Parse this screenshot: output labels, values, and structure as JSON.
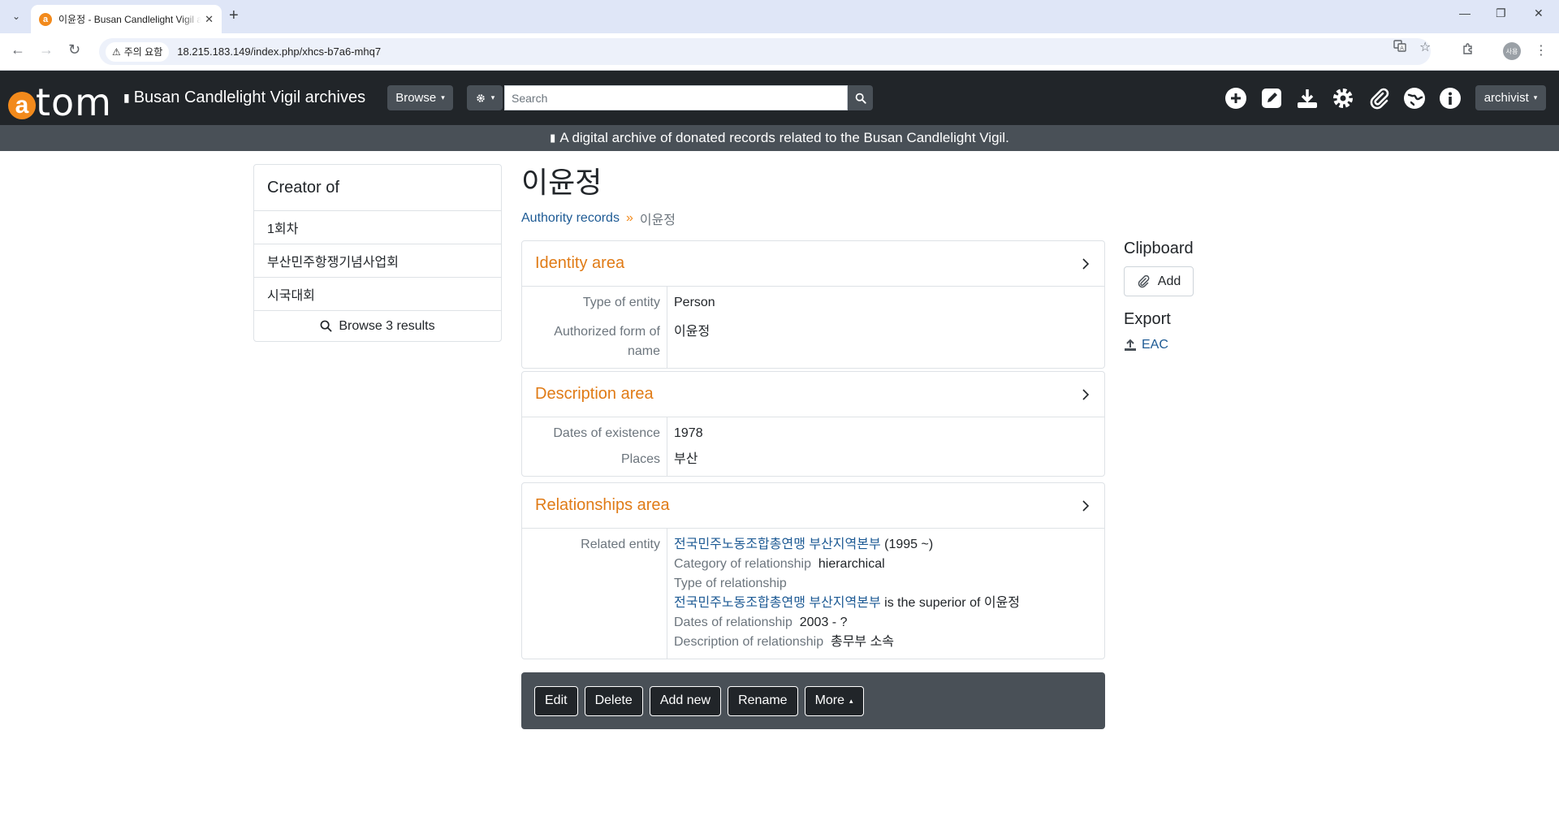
{
  "browser": {
    "tab_title": "이윤정 - Busan Candlelight Vigil archives",
    "security_label": "주의 요함",
    "url": "18.215.183.149/index.php/xhcs-b7a6-mhq7",
    "profile_initials": "사용"
  },
  "header": {
    "logo_text": "tom",
    "logo_letter": "a",
    "site_name": "Busan Candlelight Vigil archives",
    "browse_label": "Browse",
    "search_placeholder": "Search",
    "user_label": "archivist",
    "description": "A digital archive of donated records related to the Busan Candlelight Vigil."
  },
  "sidebar": {
    "heading": "Creator of",
    "items": [
      {
        "label": "1회차"
      },
      {
        "label": "부산민주항쟁기념사업회"
      },
      {
        "label": "시국대회"
      }
    ],
    "browse_label": "Browse 3 results"
  },
  "main": {
    "title": "이윤정",
    "breadcrumb": {
      "parent": "Authority records",
      "separator": "»",
      "current": "이윤정"
    },
    "identity": {
      "title": "Identity area",
      "type_label": "Type of entity",
      "type_value": "Person",
      "auth_label_1": "Authorized form of",
      "auth_label_2": "name",
      "auth_value": "이윤정"
    },
    "description": {
      "title": "Description area",
      "dates_label": "Dates of existence",
      "dates_value": "1978",
      "places_label": "Places",
      "places_value": "부산"
    },
    "relationships": {
      "title": "Relationships area",
      "related_label": "Related entity",
      "entity_link": "전국민주노동조합총연맹 부산지역본부",
      "entity_dates": "(1995 ~)",
      "category_label": "Category of relationship",
      "category_value": "hierarchical",
      "type_label": "Type of relationship",
      "superior_link": "전국민주노동조합총연맹 부산지역본부",
      "superior_text": "is the superior of 이윤정",
      "dates_label": "Dates of relationship",
      "dates_value": "2003 - ?",
      "desc_label": "Description of relationship",
      "desc_value": "총무부 소속"
    }
  },
  "right": {
    "clipboard_heading": "Clipboard",
    "add_label": "Add",
    "export_heading": "Export",
    "eac_label": "EAC"
  },
  "actions": {
    "edit": "Edit",
    "delete": "Delete",
    "add_new": "Add new",
    "rename": "Rename",
    "more": "More"
  },
  "colors": {
    "header_bg": "#212529",
    "subheader_bg": "#495057",
    "accent_orange": "#f28a1c",
    "link_blue": "#1d5a94"
  }
}
